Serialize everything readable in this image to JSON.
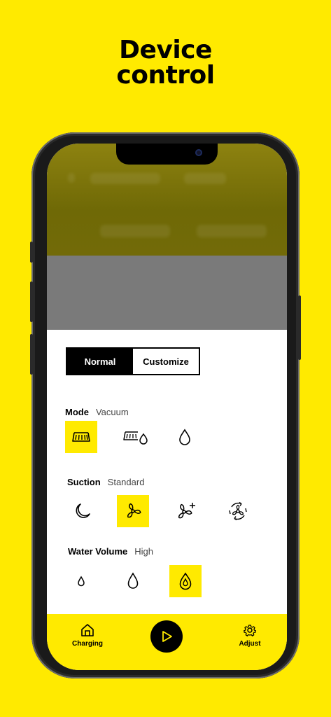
{
  "headline": {
    "line1": "Device",
    "line2": "control"
  },
  "colors": {
    "accent": "#FFEA00",
    "ink": "#000000",
    "sheet": "#FFFFFF"
  },
  "mode_toggle": {
    "normal": "Normal",
    "customize": "Customize",
    "selected": "Normal"
  },
  "mode": {
    "label": "Mode",
    "value": "Vacuum",
    "options": [
      {
        "icon": "vacuum-brush-icon",
        "selected": true
      },
      {
        "icon": "vacuum-and-mop-icon",
        "selected": false
      },
      {
        "icon": "mop-drop-icon",
        "selected": false
      }
    ]
  },
  "suction": {
    "label": "Suction",
    "value": "Standard",
    "options": [
      {
        "icon": "quiet-moon-icon",
        "selected": false
      },
      {
        "icon": "fan-standard-icon",
        "selected": true
      },
      {
        "icon": "fan-plus-icon",
        "selected": false
      },
      {
        "icon": "max-rotate-icon",
        "selected": false
      }
    ]
  },
  "water": {
    "label": "Water Volume",
    "value": "High",
    "options": [
      {
        "icon": "water-low-icon",
        "selected": false
      },
      {
        "icon": "water-medium-icon",
        "selected": false
      },
      {
        "icon": "water-high-icon",
        "selected": true
      }
    ]
  },
  "bottom_nav": {
    "charging": "Charging",
    "adjust": "Adjust",
    "play_icon": "play-icon"
  }
}
